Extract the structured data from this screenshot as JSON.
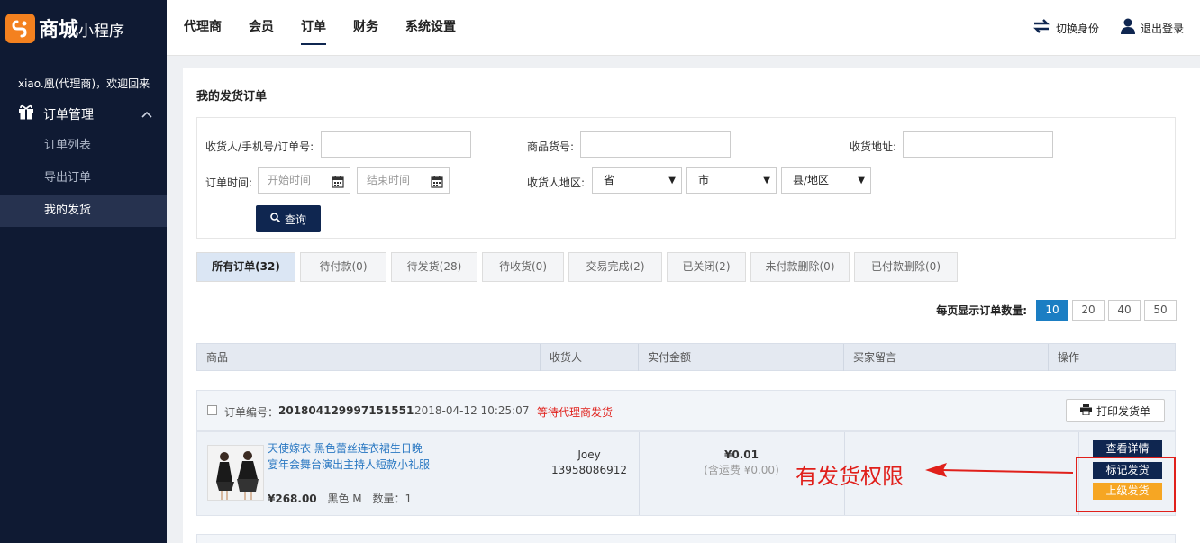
{
  "brand": {
    "mark": "S",
    "title_bold": "商城",
    "title_small": "小程序"
  },
  "nav": {
    "items": [
      "代理商",
      "会员",
      "订单",
      "财务",
      "系统设置"
    ],
    "active": 2
  },
  "topRight": {
    "switch_label": "切换身份",
    "logout_label": "退出登录"
  },
  "sidebar": {
    "welcome": "xiao.凰(代理商)，欢迎回来",
    "menu_head": "订单管理",
    "sub_items": [
      "订单列表",
      "导出订单",
      "我的发货"
    ],
    "active": 2
  },
  "page": {
    "title": "我的发货订单"
  },
  "filter": {
    "receiver_label": "收货人/手机号/订单号:",
    "sku_label": "商品货号:",
    "address_label": "收货地址:",
    "time_label": "订单时间:",
    "start_placeholder": "开始时间",
    "end_placeholder": "结束时间",
    "region_label": "收货人地区:",
    "province": "省",
    "city": "市",
    "district": "县/地区",
    "query_label": "查询"
  },
  "tabs": [
    "所有订单(32)",
    "待付款(0)",
    "待发货(28)",
    "待收货(0)",
    "交易完成(2)",
    "已关闭(2)",
    "未付款删除(0)",
    "已付款删除(0)"
  ],
  "pager": {
    "label": "每页显示订单数量:",
    "options": [
      "10",
      "20",
      "40",
      "50"
    ],
    "active": "10"
  },
  "table": {
    "headers": [
      "商品",
      "收货人",
      "实付金额",
      "买家留言",
      "操作"
    ]
  },
  "order": {
    "no_label": "订单编号：",
    "no": "201804129997151551",
    "time": "2018-04-12 10:25:07",
    "status": "等待代理商发货",
    "print_label": "打印发货单",
    "product_name": "天使嫁衣 黑色蕾丝连衣裙生日晚宴年会舞台演出主持人短款小礼服",
    "price": "¥268.00",
    "spec": "黑色 M",
    "qty": "数量：1",
    "receiver_name": "Joey",
    "receiver_phone": "13958086912",
    "amount": "¥0.01",
    "shipping": "(含运费 ¥0.00)",
    "btn_detail": "查看详情",
    "btn_mark": "标记发货",
    "btn_upper": "上级发货"
  },
  "annotation": {
    "text": "有发货权限"
  },
  "colors": {
    "accent": "#0f2650",
    "orange": "#f6a623",
    "brand_orange": "#f4811f",
    "red": "#e0201b",
    "link": "#2a78c2"
  }
}
